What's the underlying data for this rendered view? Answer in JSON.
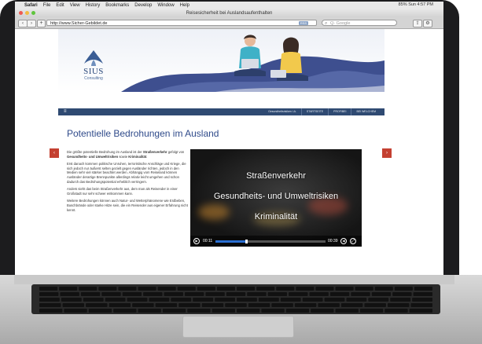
{
  "menubar": {
    "apple": "",
    "items": [
      "Safari",
      "File",
      "Edit",
      "View",
      "History",
      "Bookmarks",
      "Develop",
      "Window",
      "Help"
    ],
    "status": "85%  Sun 4:57 PM"
  },
  "window": {
    "title": "Reisesicherheit bei Auslandsaufenthalten"
  },
  "toolbar": {
    "back": "‹",
    "forward": "›",
    "add": "+",
    "url": "http://www.Sicher-Gebildet.de",
    "rss": "RSS",
    "search_placeholder": "Q- Google"
  },
  "brand": {
    "name": "SIUS",
    "sub": "Consulting",
    "color": "#2d4a7c"
  },
  "nav": {
    "menu_icon": "≡",
    "items": [
      "Gesundheitsrisiken i.A.",
      "STARTSEITE",
      "PROFIBEI",
      "BEI WELCHEM"
    ]
  },
  "main": {
    "heading": "Potentielle Bedrohungen im Ausland",
    "prev": "‹",
    "next": "›",
    "p1_pre": "Die größte potentielle Bedrohung im Ausland ist der ",
    "p1_b1": "Straßenverkehr",
    "p1_mid": " gefolgt von ",
    "p1_b2": "Gesundheits- und Umweltrisiken",
    "p1_mid2": " sowie ",
    "p1_b3": "Kriminalität",
    "p1_end": ".",
    "p2": "Erst danach kommen politische Unruhen, terroristische Anschläge und Kriege, die sich jedoch nur äußerst selten gezielt gegen Ausländer richten, jedoch in den Medien sehr viel stärker beachtet werden. Abhängig vom Reiseland können Ausländer derartige Brennpunkte allerdings relativ leicht umgehen und schon dadurch das Bedrohungspotential erheblich verringern.",
    "p3": "Anders sieht das beim Straßenverkehr aus, dem man als Reisender in einer Großstadt nur sehr schwer entkommen kann.",
    "p4": "Weitere Bedrohungen können auch Natur- und Wetterphänomene wie Erdbeben, Buschbrände oder starke Hitze sein, die ein Reisender aus eigener Erfahrung nicht kennt."
  },
  "video": {
    "line1": "Straßenverkehr",
    "line2": "Gesundheits- und Umweltrisiken",
    "line3": "Kriminalität",
    "current_time": "00:11",
    "end_time": "00:39",
    "progress": 0.28,
    "accent": "#2a6fd1"
  }
}
